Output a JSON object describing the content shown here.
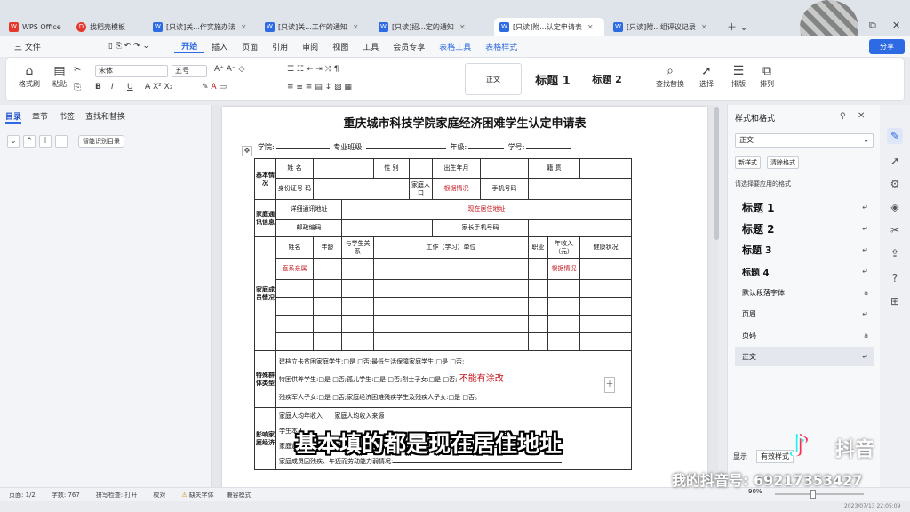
{
  "tabs": [
    {
      "label": "WPS Office",
      "icon": "wps-logo-icon"
    },
    {
      "label": "找稻壳模板",
      "icon": "docer-icon"
    },
    {
      "label": "[只读]关...作实施办法",
      "icon": "doc-icon"
    },
    {
      "label": "[只读]关...工作的通知",
      "icon": "doc-icon"
    },
    {
      "label": "[只读]招...定的通知",
      "icon": "doc-icon"
    },
    {
      "label": "[只读]附...认定申请表",
      "icon": "doc-icon",
      "active": true
    },
    {
      "label": "[只读]附...组评议记录",
      "icon": "doc-icon"
    }
  ],
  "menu": {
    "file": "三 文件",
    "items": [
      "开始",
      "插入",
      "页面",
      "引用",
      "审阅",
      "视图",
      "工具",
      "会员专享",
      "表格工具",
      "表格样式"
    ],
    "share": "分享"
  },
  "ribbon": {
    "format_painter": "格式刷",
    "paste": "粘贴",
    "font_name": "宋体",
    "font_size": "五号",
    "styles": [
      "正文",
      "标题 1",
      "标题 2"
    ],
    "find_replace": "查找替换",
    "select": "选择",
    "layout": "排版",
    "arrange": "排列"
  },
  "nav": {
    "tabs": [
      "目录",
      "章节",
      "书签",
      "查找和替换"
    ],
    "smart_toc": "智能识别目录"
  },
  "doc": {
    "title": "重庆城市科技学院家庭经济困难学生认定申请表",
    "college": "学院:",
    "major": "专业班级:",
    "grade": "年级:",
    "student_id": "学号:",
    "basic": "基本情况",
    "name": "姓 名",
    "gender": "性 别",
    "birth": "出生年月",
    "native": "籍 贯",
    "id_no": "身份证号 码",
    "household": "家庭人口",
    "by_fact": "根据情况",
    "phone": "手机号码",
    "comm": "家庭通讯信息",
    "addr": "详细通讯地址",
    "addr_val": "现在居住地址",
    "postcode": "邮政编码",
    "parent_phone": "家长手机号码",
    "members": "家庭成员情况",
    "m_name": "姓名",
    "m_age": "年龄",
    "m_rel": "与学生关系",
    "m_work": "工作（学习）单位",
    "m_job": "职业",
    "m_income": "年收入（元）",
    "m_health": "健康状况",
    "direct": "直系亲属",
    "by_fact2": "根据情况",
    "special": "特殊群体类型",
    "sp1": "建档立卡贫困家庭学生:□是 □否;最低生活保障家庭学生:□是 □否;",
    "sp2": "特困供养学生:□是 □否;孤儿学生:□是 □否;烈士子女:□是 □否;",
    "no_alter": "不能有涂改",
    "sp3": "残疾军人子女:□是 □否;家庭经济困难残疾学生及残疾人子女:□是 □否。",
    "factors": "影响家庭经济",
    "f1a": "家庭人均年收入",
    "f1b": "家庭人均收入来源",
    "f2": "学生本人",
    "f3": "家庭遭受自然灾害情况:",
    "f3b": "家庭遭受突发意外事件:",
    "f4": "家庭成员因残疾、年迈而劳动能力弱情况:"
  },
  "style_pane": {
    "title": "样式和格式",
    "current": "正文",
    "new_style": "新样式",
    "clear_format": "清除格式",
    "choose": "请选择要应用的格式",
    "items": [
      "标题 1",
      "标题 2",
      "标题 3",
      "标题 4",
      "默认段落字体",
      "页眉",
      "页码",
      "正文"
    ],
    "show": "显示",
    "valid_style": "有效样式"
  },
  "status": {
    "page": "页面: 1/2",
    "words": "字数: 767",
    "spell": "拼写检查: 打开",
    "proof": "校对",
    "missing_font": "缺失字体",
    "compat": "兼容模式",
    "zoom": "90%"
  },
  "overlay": {
    "subtitle": "基本填的都是现在居住地址",
    "douyin": "抖音",
    "douyin_id": "我的抖音号: 69217353427",
    "timestamp": "2023/07/13 22:05:09"
  },
  "colors": {
    "accent": "#2d6ae3",
    "annotation_red": "#c3161c"
  }
}
